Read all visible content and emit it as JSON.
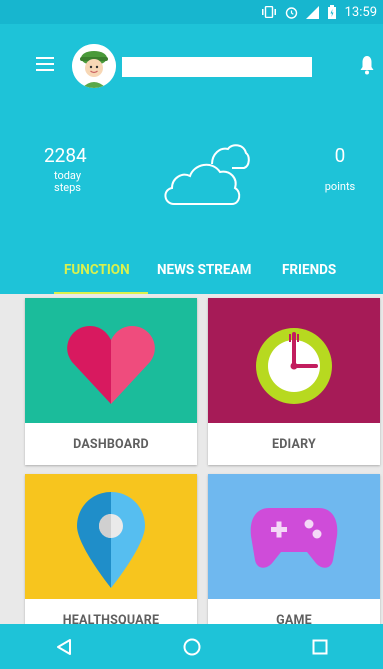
{
  "status_bar": {
    "time": "13:59"
  },
  "header": {
    "steps": {
      "value": "2284",
      "label": "today steps"
    },
    "points": {
      "value": "0",
      "label": "points"
    }
  },
  "tabs": [
    {
      "label": "FUNCTION",
      "active": true
    },
    {
      "label": "NEWS STREAM",
      "active": false
    },
    {
      "label": "FRIENDS",
      "active": false
    }
  ],
  "cards": [
    {
      "label": "DASHBOARD",
      "color": "#1bbc9b"
    },
    {
      "label": "EDIARY",
      "color": "#a61b57"
    },
    {
      "label": "HEALTHSQUARE",
      "color": "#f7c51e"
    },
    {
      "label": "GAME",
      "color": "#6fb8ef"
    }
  ],
  "colors": {
    "primary": "#1ec3d8",
    "tab_active": "#d9f14e"
  },
  "icons": [
    "menu-icon",
    "bell-icon",
    "cloud-icon",
    "heart-icon",
    "clock-icon",
    "location-pin-icon",
    "gamepad-icon",
    "back-icon",
    "home-icon",
    "recents-icon"
  ]
}
